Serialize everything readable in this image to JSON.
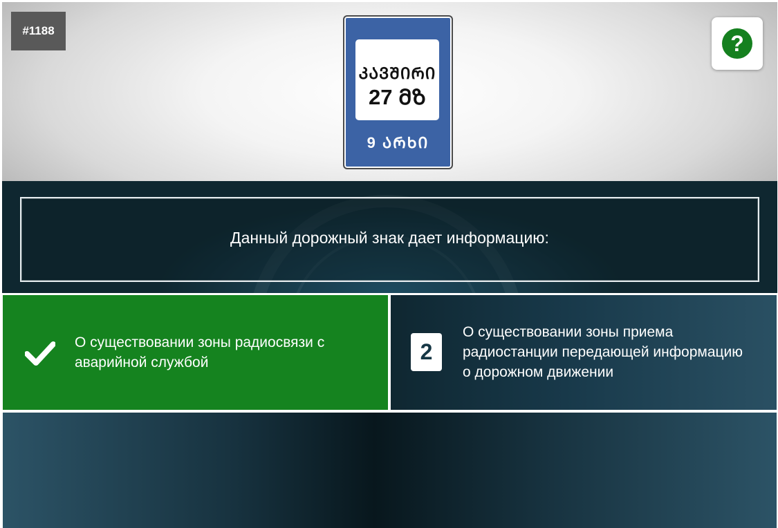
{
  "header": {
    "question_id": "#1188",
    "help_icon_label": "?"
  },
  "sign": {
    "line1": "ᲙᲐᲕᲨᲘᲠᲘ",
    "line2": "27 ᲛᲖ",
    "bottom": "9 ᲐᲠᲮᲘ",
    "colors": {
      "background": "#3c63a5",
      "panel": "#ffffff"
    }
  },
  "question": {
    "text": "Данный дорожный знак дает информацию:"
  },
  "answers": [
    {
      "text": "О существовании зоны радиосвязи с аварийной службой",
      "icon": "check-icon",
      "state": "correct",
      "color": "#15831f"
    },
    {
      "number": "2",
      "text": "О существовании зоны приема радиостанции передающей информацию о дорожном движении",
      "state": "default",
      "color": "#18394a"
    }
  ]
}
